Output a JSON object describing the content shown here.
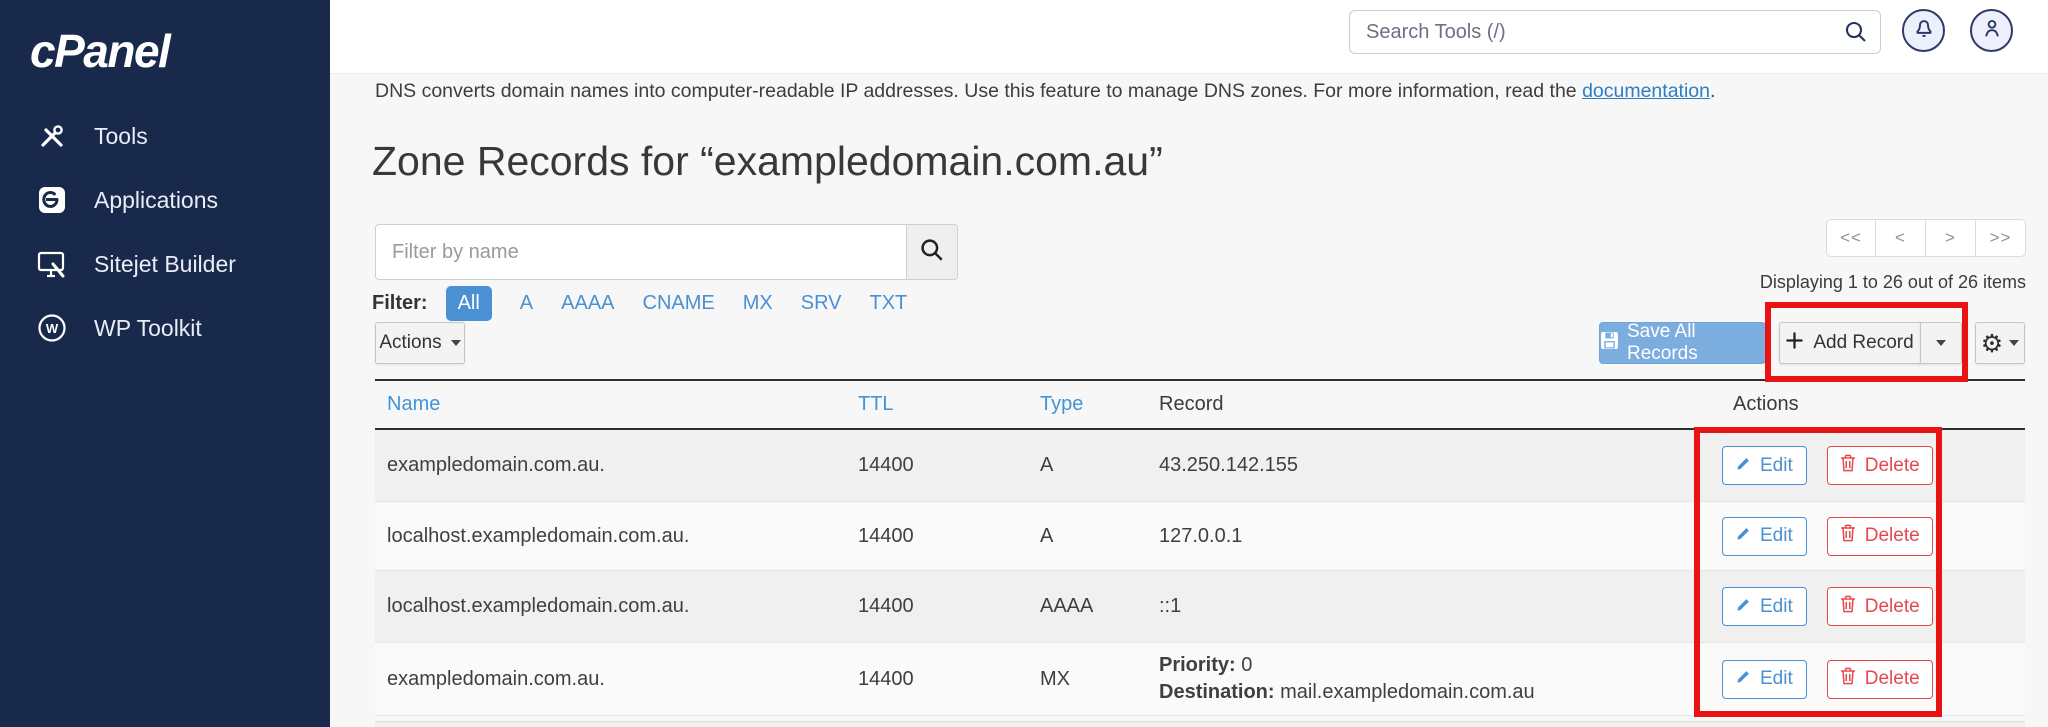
{
  "brand": {
    "logo": "cPanel"
  },
  "sidebar": {
    "items": [
      {
        "label": "Tools",
        "icon": "tools-icon"
      },
      {
        "label": "Applications",
        "icon": "applications-icon"
      },
      {
        "label": "Sitejet Builder",
        "icon": "sitejet-icon"
      },
      {
        "label": "WP Toolkit",
        "icon": "wordpress-icon"
      }
    ]
  },
  "topbar": {
    "search_placeholder": "Search Tools (/)"
  },
  "page": {
    "description": "DNS converts domain names into computer-readable IP addresses. Use this feature to manage DNS zones. For more information, read the ",
    "description_link": "documentation",
    "description_suffix": ".",
    "title": "Zone Records for “exampledomain.com.au”"
  },
  "filter": {
    "placeholder": "Filter by name",
    "label": "Filter:",
    "active": "All",
    "types": [
      "A",
      "AAAA",
      "CNAME",
      "MX",
      "SRV",
      "TXT"
    ]
  },
  "pagination": {
    "first": "<<",
    "prev": "<",
    "next": ">",
    "last": ">>",
    "summary": "Displaying 1 to 26 out of 26 items"
  },
  "toolbar": {
    "actions_label": "Actions",
    "save_all_label": "Save All Records",
    "add_record_label": "Add Record"
  },
  "table": {
    "headers": [
      "Name",
      "TTL",
      "Type",
      "Record",
      "Actions"
    ],
    "edit_label": "Edit",
    "delete_label": "Delete",
    "rows": [
      {
        "name": "exampledomain.com.au.",
        "ttl": "14400",
        "type": "A",
        "record": "43.250.142.155"
      },
      {
        "name": "localhost.exampledomain.com.au.",
        "ttl": "14400",
        "type": "A",
        "record": "127.0.0.1"
      },
      {
        "name": "localhost.exampledomain.com.au.",
        "ttl": "14400",
        "type": "AAAA",
        "record": "::1"
      },
      {
        "name": "exampledomain.com.au.",
        "ttl": "14400",
        "type": "MX",
        "record_lines": [
          {
            "label": "Priority:",
            "value": " 0"
          },
          {
            "label": "Destination:",
            "value": " mail.exampledomain.com.au"
          }
        ]
      }
    ]
  },
  "icons": {
    "gear": "⚙",
    "caret": "▾",
    "plus": "+",
    "search": "magnifier",
    "bell": "bell-outline",
    "user": "person-outline",
    "save": "floppy-disk",
    "edit": "pencil",
    "delete": "trash-can"
  },
  "colors": {
    "sidebar_bg": "#19294c",
    "link_blue": "#4a90d2",
    "table_header_link": "#4493d6",
    "save_button_bg": "#7caddf",
    "delete_red": "#e5484d",
    "annotation_red": "#e81414",
    "navy_icon": "#2c3c66"
  }
}
